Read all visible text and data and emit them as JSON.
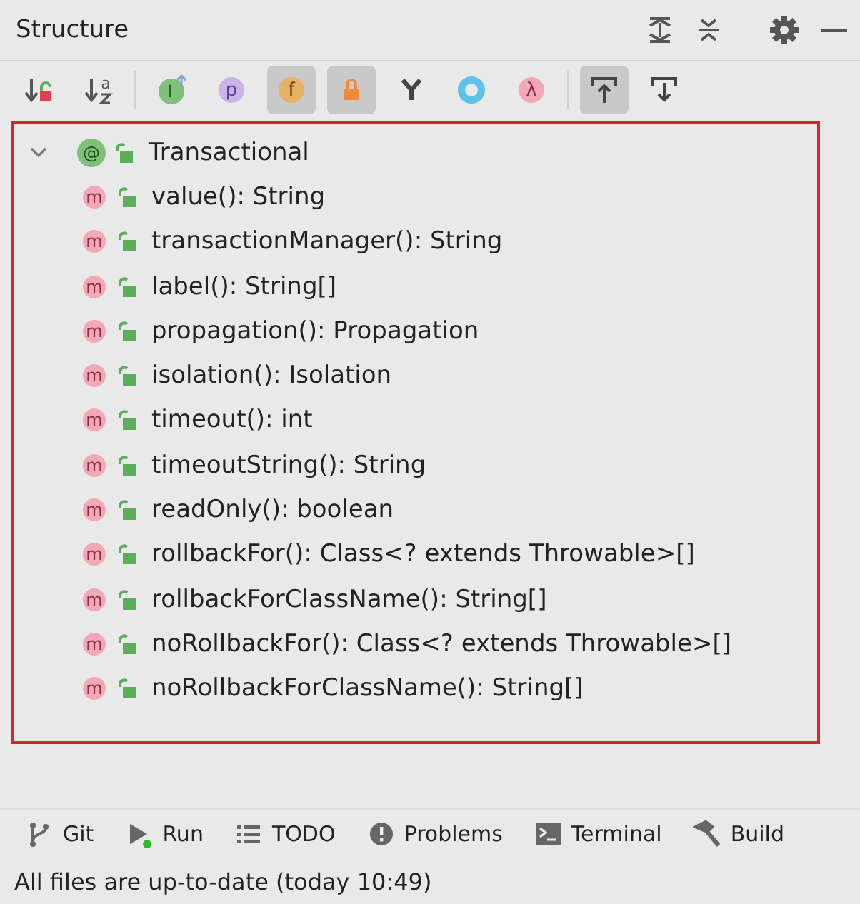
{
  "panel": {
    "title": "Structure"
  },
  "toolbar": [
    {
      "kind": "sort-visibility",
      "selected": false
    },
    {
      "kind": "sort-alpha",
      "glyph": "a",
      "selected": false
    },
    {
      "kind": "inherited",
      "glyph": "I",
      "selected": false
    },
    {
      "kind": "properties",
      "glyph": "p",
      "selected": false
    },
    {
      "kind": "fields",
      "glyph": "f",
      "selected": true
    },
    {
      "kind": "non-public",
      "selected": true
    },
    {
      "kind": "split",
      "selected": false
    },
    {
      "kind": "anonymous",
      "selected": false
    },
    {
      "kind": "lambdas",
      "glyph": "λ",
      "selected": false
    },
    {
      "kind": "autoscroll-to",
      "selected": true
    },
    {
      "kind": "autoscroll-from",
      "selected": false
    }
  ],
  "tree": {
    "highlighted": true,
    "root": {
      "label": "Transactional",
      "badge": "@",
      "kind": "annotation",
      "expanded": true,
      "children": [
        {
          "label": "value(): String",
          "badge": "m",
          "kind": "method"
        },
        {
          "label": "transactionManager(): String",
          "badge": "m",
          "kind": "method"
        },
        {
          "label": "label(): String[]",
          "badge": "m",
          "kind": "method"
        },
        {
          "label": "propagation(): Propagation",
          "badge": "m",
          "kind": "method"
        },
        {
          "label": "isolation(): Isolation",
          "badge": "m",
          "kind": "method"
        },
        {
          "label": "timeout(): int",
          "badge": "m",
          "kind": "method"
        },
        {
          "label": "timeoutString(): String",
          "badge": "m",
          "kind": "method"
        },
        {
          "label": "readOnly(): boolean",
          "badge": "m",
          "kind": "method"
        },
        {
          "label": "rollbackFor(): Class<? extends Throwable>[]",
          "badge": "m",
          "kind": "method"
        },
        {
          "label": "rollbackForClassName(): String[]",
          "badge": "m",
          "kind": "method"
        },
        {
          "label": "noRollbackFor(): Class<? extends Throwable>[]",
          "badge": "m",
          "kind": "method"
        },
        {
          "label": "noRollbackForClassName(): String[]",
          "badge": "m",
          "kind": "method"
        }
      ]
    }
  },
  "tool_tabs": [
    {
      "label": "Git",
      "kind": "git"
    },
    {
      "label": "Run",
      "kind": "run"
    },
    {
      "label": "TODO",
      "kind": "todo"
    },
    {
      "label": "Problems",
      "kind": "problems"
    },
    {
      "label": "Terminal",
      "kind": "terminal"
    },
    {
      "label": "Build",
      "kind": "build"
    }
  ],
  "status_bar": "All files are up-to-date (today 10:49)"
}
